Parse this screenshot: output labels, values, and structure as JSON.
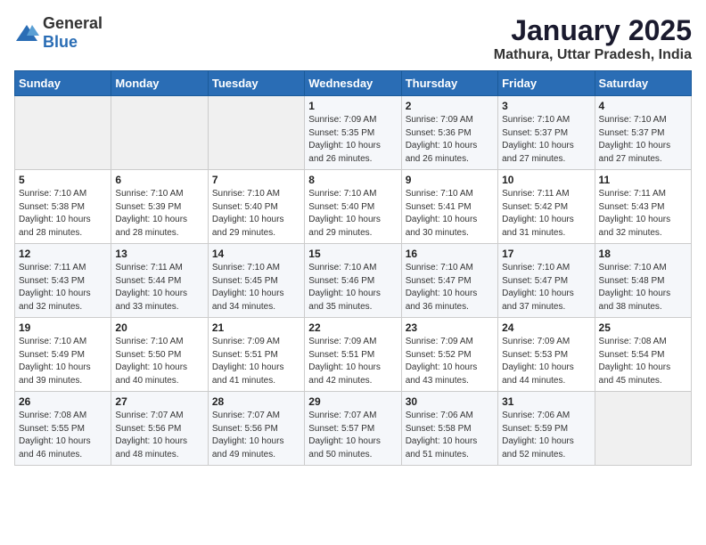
{
  "logo": {
    "text_general": "General",
    "text_blue": "Blue"
  },
  "title": "January 2025",
  "location": "Mathura, Uttar Pradesh, India",
  "days_of_week": [
    "Sunday",
    "Monday",
    "Tuesday",
    "Wednesday",
    "Thursday",
    "Friday",
    "Saturday"
  ],
  "weeks": [
    [
      {
        "day": "",
        "sunrise": "",
        "sunset": "",
        "daylight": ""
      },
      {
        "day": "",
        "sunrise": "",
        "sunset": "",
        "daylight": ""
      },
      {
        "day": "",
        "sunrise": "",
        "sunset": "",
        "daylight": ""
      },
      {
        "day": "1",
        "sunrise": "Sunrise: 7:09 AM",
        "sunset": "Sunset: 5:35 PM",
        "daylight": "Daylight: 10 hours and 26 minutes."
      },
      {
        "day": "2",
        "sunrise": "Sunrise: 7:09 AM",
        "sunset": "Sunset: 5:36 PM",
        "daylight": "Daylight: 10 hours and 26 minutes."
      },
      {
        "day": "3",
        "sunrise": "Sunrise: 7:10 AM",
        "sunset": "Sunset: 5:37 PM",
        "daylight": "Daylight: 10 hours and 27 minutes."
      },
      {
        "day": "4",
        "sunrise": "Sunrise: 7:10 AM",
        "sunset": "Sunset: 5:37 PM",
        "daylight": "Daylight: 10 hours and 27 minutes."
      }
    ],
    [
      {
        "day": "5",
        "sunrise": "Sunrise: 7:10 AM",
        "sunset": "Sunset: 5:38 PM",
        "daylight": "Daylight: 10 hours and 28 minutes."
      },
      {
        "day": "6",
        "sunrise": "Sunrise: 7:10 AM",
        "sunset": "Sunset: 5:39 PM",
        "daylight": "Daylight: 10 hours and 28 minutes."
      },
      {
        "day": "7",
        "sunrise": "Sunrise: 7:10 AM",
        "sunset": "Sunset: 5:40 PM",
        "daylight": "Daylight: 10 hours and 29 minutes."
      },
      {
        "day": "8",
        "sunrise": "Sunrise: 7:10 AM",
        "sunset": "Sunset: 5:40 PM",
        "daylight": "Daylight: 10 hours and 29 minutes."
      },
      {
        "day": "9",
        "sunrise": "Sunrise: 7:10 AM",
        "sunset": "Sunset: 5:41 PM",
        "daylight": "Daylight: 10 hours and 30 minutes."
      },
      {
        "day": "10",
        "sunrise": "Sunrise: 7:11 AM",
        "sunset": "Sunset: 5:42 PM",
        "daylight": "Daylight: 10 hours and 31 minutes."
      },
      {
        "day": "11",
        "sunrise": "Sunrise: 7:11 AM",
        "sunset": "Sunset: 5:43 PM",
        "daylight": "Daylight: 10 hours and 32 minutes."
      }
    ],
    [
      {
        "day": "12",
        "sunrise": "Sunrise: 7:11 AM",
        "sunset": "Sunset: 5:43 PM",
        "daylight": "Daylight: 10 hours and 32 minutes."
      },
      {
        "day": "13",
        "sunrise": "Sunrise: 7:11 AM",
        "sunset": "Sunset: 5:44 PM",
        "daylight": "Daylight: 10 hours and 33 minutes."
      },
      {
        "day": "14",
        "sunrise": "Sunrise: 7:10 AM",
        "sunset": "Sunset: 5:45 PM",
        "daylight": "Daylight: 10 hours and 34 minutes."
      },
      {
        "day": "15",
        "sunrise": "Sunrise: 7:10 AM",
        "sunset": "Sunset: 5:46 PM",
        "daylight": "Daylight: 10 hours and 35 minutes."
      },
      {
        "day": "16",
        "sunrise": "Sunrise: 7:10 AM",
        "sunset": "Sunset: 5:47 PM",
        "daylight": "Daylight: 10 hours and 36 minutes."
      },
      {
        "day": "17",
        "sunrise": "Sunrise: 7:10 AM",
        "sunset": "Sunset: 5:47 PM",
        "daylight": "Daylight: 10 hours and 37 minutes."
      },
      {
        "day": "18",
        "sunrise": "Sunrise: 7:10 AM",
        "sunset": "Sunset: 5:48 PM",
        "daylight": "Daylight: 10 hours and 38 minutes."
      }
    ],
    [
      {
        "day": "19",
        "sunrise": "Sunrise: 7:10 AM",
        "sunset": "Sunset: 5:49 PM",
        "daylight": "Daylight: 10 hours and 39 minutes."
      },
      {
        "day": "20",
        "sunrise": "Sunrise: 7:10 AM",
        "sunset": "Sunset: 5:50 PM",
        "daylight": "Daylight: 10 hours and 40 minutes."
      },
      {
        "day": "21",
        "sunrise": "Sunrise: 7:09 AM",
        "sunset": "Sunset: 5:51 PM",
        "daylight": "Daylight: 10 hours and 41 minutes."
      },
      {
        "day": "22",
        "sunrise": "Sunrise: 7:09 AM",
        "sunset": "Sunset: 5:51 PM",
        "daylight": "Daylight: 10 hours and 42 minutes."
      },
      {
        "day": "23",
        "sunrise": "Sunrise: 7:09 AM",
        "sunset": "Sunset: 5:52 PM",
        "daylight": "Daylight: 10 hours and 43 minutes."
      },
      {
        "day": "24",
        "sunrise": "Sunrise: 7:09 AM",
        "sunset": "Sunset: 5:53 PM",
        "daylight": "Daylight: 10 hours and 44 minutes."
      },
      {
        "day": "25",
        "sunrise": "Sunrise: 7:08 AM",
        "sunset": "Sunset: 5:54 PM",
        "daylight": "Daylight: 10 hours and 45 minutes."
      }
    ],
    [
      {
        "day": "26",
        "sunrise": "Sunrise: 7:08 AM",
        "sunset": "Sunset: 5:55 PM",
        "daylight": "Daylight: 10 hours and 46 minutes."
      },
      {
        "day": "27",
        "sunrise": "Sunrise: 7:07 AM",
        "sunset": "Sunset: 5:56 PM",
        "daylight": "Daylight: 10 hours and 48 minutes."
      },
      {
        "day": "28",
        "sunrise": "Sunrise: 7:07 AM",
        "sunset": "Sunset: 5:56 PM",
        "daylight": "Daylight: 10 hours and 49 minutes."
      },
      {
        "day": "29",
        "sunrise": "Sunrise: 7:07 AM",
        "sunset": "Sunset: 5:57 PM",
        "daylight": "Daylight: 10 hours and 50 minutes."
      },
      {
        "day": "30",
        "sunrise": "Sunrise: 7:06 AM",
        "sunset": "Sunset: 5:58 PM",
        "daylight": "Daylight: 10 hours and 51 minutes."
      },
      {
        "day": "31",
        "sunrise": "Sunrise: 7:06 AM",
        "sunset": "Sunset: 5:59 PM",
        "daylight": "Daylight: 10 hours and 52 minutes."
      },
      {
        "day": "",
        "sunrise": "",
        "sunset": "",
        "daylight": ""
      }
    ]
  ]
}
